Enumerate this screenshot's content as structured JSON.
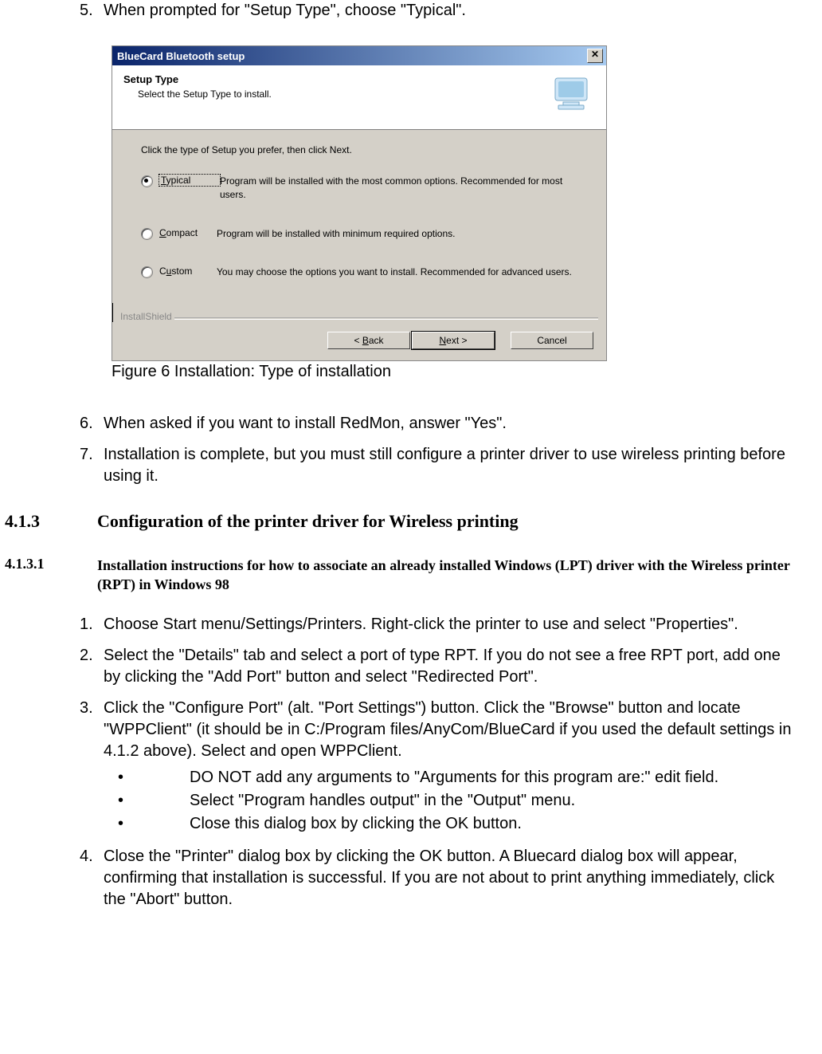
{
  "doc": {
    "step5": {
      "num": "5.",
      "text": "When prompted for \"Setup Type\", choose \"Typical\"."
    },
    "figcaption": "Figure 6 Installation: Type of installation",
    "step6": {
      "num": "6.",
      "text": "When asked if you want to install RedMon, answer \"Yes\"."
    },
    "step7": {
      "num": "7.",
      "text": "Installation is complete, but you must still configure a printer driver to use wireless printing before using it."
    },
    "h3": {
      "num": "4.1.3",
      "text": "Configuration of the printer driver for Wireless printing"
    },
    "h4": {
      "num": "4.1.3.1",
      "text": "Installation instructions for how to associate an already installed Windows (LPT) driver with the Wireless printer (RPT) in Windows 98"
    },
    "s2": {
      "i1": {
        "num": "1.",
        "text": "Choose Start menu/Settings/Printers. Right-click the printer to use and select \"Properties\"."
      },
      "i2": {
        "num": "2.",
        "text": "Select the \"Details\" tab and select a port of type RPT. If you do not see a free RPT port, add one by clicking the \"Add Port\" button and select \"Redirected Port\"."
      },
      "i3": {
        "num": "3.",
        "text": "Click the \"Configure Port\" (alt. \"Port Settings\") button. Click the \"Browse\" button and locate \"WPPClient\" (it should be in C:/Program files/AnyCom/BlueCard if you used the default settings in 4.1.2 above). Select and open WPPClient.",
        "b1": "DO NOT add any arguments to \"Arguments for this program are:\" edit field.",
        "b2": "Select \"Program handles output\" in the \"Output\" menu.",
        "b3": "Close this dialog box by clicking the OK button."
      },
      "i4": {
        "num": "4.",
        "text": "Close the \"Printer\" dialog box by clicking the OK button. A  Bluecard dialog box will appear, confirming that installation is successful. If you are not about to print anything immediately, click the \"Abort\" button."
      }
    }
  },
  "win": {
    "title": "BlueCard Bluetooth setup",
    "header": {
      "title": "Setup Type",
      "sub": "Select the Setup Type to install."
    },
    "intro": "Click the type of Setup you prefer, then click Next.",
    "options": {
      "typical": {
        "label_pre": "T",
        "label_rest": "ypical",
        "desc": "Program will be installed with the most common options.  Recommended for most users."
      },
      "compact": {
        "label_pre": "C",
        "label_rest": "ompact",
        "desc": "Program will be installed with minimum required options."
      },
      "custom": {
        "label_pre": "C",
        "label_rest": "ustom",
        "label_prefix_plain": "C",
        "desc": "You may choose the options you want to install. Recommended for advanced users."
      }
    },
    "shield": "InstallShield",
    "buttons": {
      "back": {
        "lt": "< ",
        "ul": "B",
        "rest": "ack"
      },
      "next": {
        "ul": "N",
        "rest": "ext >"
      },
      "cancel": "Cancel"
    }
  }
}
